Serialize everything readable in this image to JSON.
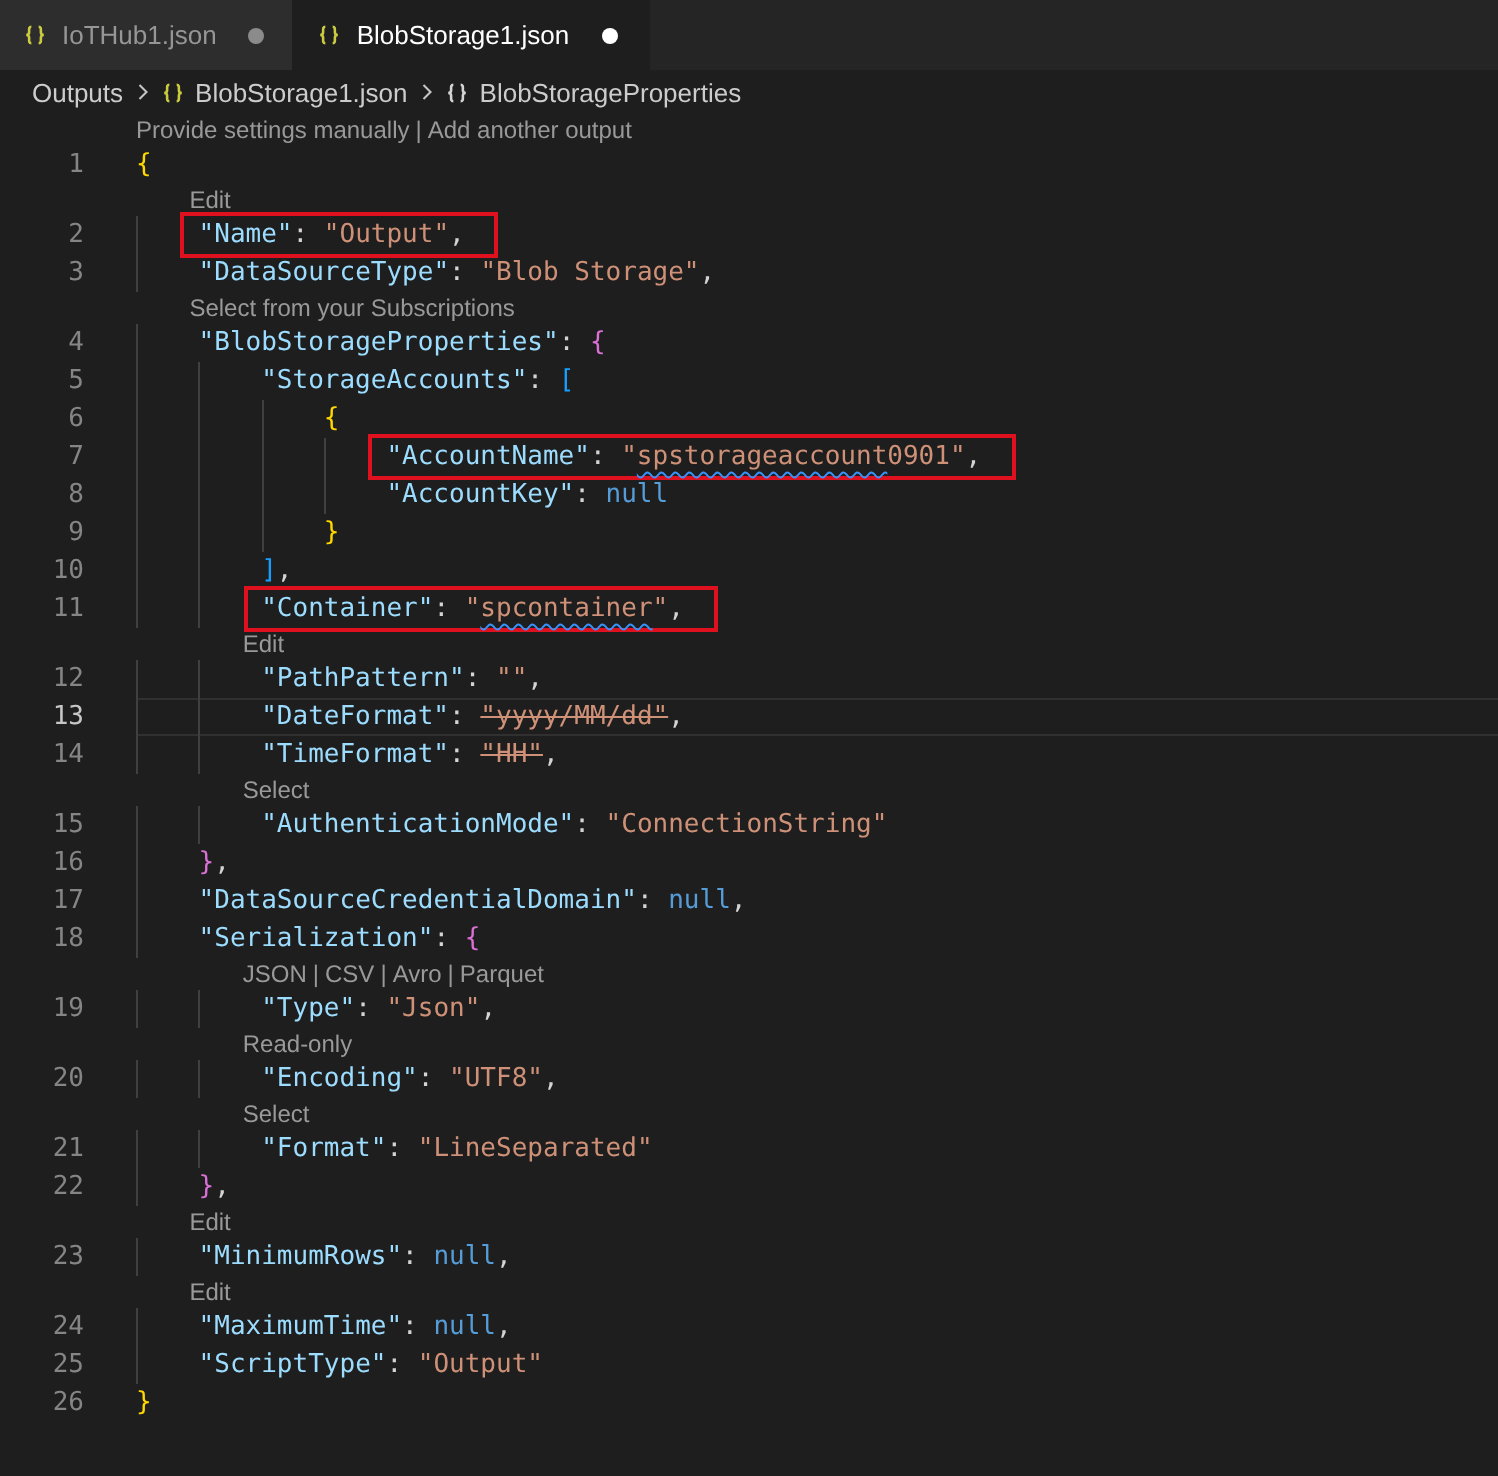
{
  "tabs": [
    {
      "label": "IoTHub1.json",
      "selected": false,
      "modified": true
    },
    {
      "label": "BlobStorage1.json",
      "selected": true,
      "modified": true
    }
  ],
  "breadcrumb": [
    {
      "text": "Outputs",
      "kind": "folder"
    },
    {
      "text": "BlobStorage1.json",
      "kind": "file"
    },
    {
      "text": "BlobStorageProperties",
      "kind": "symbol"
    }
  ],
  "lines": [
    {
      "number": "1",
      "current": false,
      "boxed": false,
      "lens": [
        {
          "text": "Provide settings manually",
          "kind": "link"
        },
        {
          "text": "|",
          "kind": "sep"
        },
        {
          "text": "Add another output",
          "kind": "link"
        }
      ],
      "tokens": [
        {
          "text": "{",
          "kind": "brace1"
        }
      ],
      "children": [
        {
          "number": "2",
          "current": false,
          "boxed": true,
          "lens": [
            {
              "text": "Edit",
              "kind": "link"
            }
          ],
          "tokens": [
            {
              "text": "\"Name\"",
              "kind": "key"
            },
            {
              "text": ": ",
              "kind": "punct"
            },
            {
              "text": "\"Output\"",
              "kind": "string"
            },
            {
              "text": ",",
              "kind": "punct"
            }
          ]
        },
        {
          "number": "3",
          "current": false,
          "boxed": false,
          "tokens": [
            {
              "text": "\"DataSourceType\"",
              "kind": "key"
            },
            {
              "text": ": ",
              "kind": "punct"
            },
            {
              "text": "\"Blob Storage\"",
              "kind": "string"
            },
            {
              "text": ",",
              "kind": "punct"
            }
          ]
        },
        {
          "number": "4",
          "current": false,
          "boxed": false,
          "lens": [
            {
              "text": "Select from your Subscriptions",
              "kind": "link"
            }
          ],
          "tokens": [
            {
              "text": "\"BlobStorageProperties\"",
              "kind": "key"
            },
            {
              "text": ": ",
              "kind": "punct"
            },
            {
              "text": "{",
              "kind": "brace2"
            }
          ],
          "children": [
            {
              "number": "5",
              "current": false,
              "boxed": false,
              "tokens": [
                {
                  "text": "\"StorageAccounts\"",
                  "kind": "key"
                },
                {
                  "text": ": ",
                  "kind": "punct"
                },
                {
                  "text": "[",
                  "kind": "brace3"
                }
              ],
              "children": [
                {
                  "number": "6",
                  "current": false,
                  "boxed": false,
                  "tokens": [
                    {
                      "text": "{",
                      "kind": "brace1"
                    }
                  ],
                  "children": [
                    {
                      "number": "7",
                      "current": false,
                      "boxed": true,
                      "tokens": [
                        {
                          "text": "\"AccountName\"",
                          "kind": "key"
                        },
                        {
                          "text": ": ",
                          "kind": "punct"
                        },
                        {
                          "text": "\"",
                          "kind": "string"
                        },
                        {
                          "text": "spstorageaccount",
                          "kind": "string",
                          "squiggle": true
                        },
                        {
                          "text": "0901\"",
                          "kind": "string"
                        },
                        {
                          "text": ",",
                          "kind": "punct"
                        }
                      ]
                    },
                    {
                      "number": "8",
                      "current": false,
                      "boxed": false,
                      "tokens": [
                        {
                          "text": "\"AccountKey\"",
                          "kind": "key"
                        },
                        {
                          "text": ": ",
                          "kind": "punct"
                        },
                        {
                          "text": "null",
                          "kind": "null"
                        }
                      ]
                    }
                  ]
                },
                {
                  "number": "9",
                  "current": false,
                  "boxed": false,
                  "tokens": [
                    {
                      "text": "}",
                      "kind": "brace1"
                    }
                  ]
                }
              ]
            },
            {
              "number": "10",
              "current": false,
              "boxed": false,
              "tokens": [
                {
                  "text": "]",
                  "kind": "brace3"
                },
                {
                  "text": ",",
                  "kind": "punct"
                }
              ]
            },
            {
              "number": "11",
              "current": false,
              "boxed": true,
              "tokens": [
                {
                  "text": "\"Container\"",
                  "kind": "key"
                },
                {
                  "text": ": ",
                  "kind": "punct"
                },
                {
                  "text": "\"",
                  "kind": "string"
                },
                {
                  "text": "spcontainer",
                  "kind": "string",
                  "squiggle": true
                },
                {
                  "text": "\"",
                  "kind": "string"
                },
                {
                  "text": ",",
                  "kind": "punct"
                }
              ]
            },
            {
              "number": "12",
              "current": false,
              "boxed": false,
              "lens": [
                {
                  "text": "Edit",
                  "kind": "link"
                }
              ],
              "tokens": [
                {
                  "text": "\"PathPattern\"",
                  "kind": "key"
                },
                {
                  "text": ": ",
                  "kind": "punct"
                },
                {
                  "text": "\"\"",
                  "kind": "string"
                },
                {
                  "text": ",",
                  "kind": "punct"
                }
              ]
            },
            {
              "number": "13",
              "current": true,
              "boxed": false,
              "tokens": [
                {
                  "text": "\"DateFormat\"",
                  "kind": "key"
                },
                {
                  "text": ": ",
                  "kind": "punct"
                },
                {
                  "text": "\"yyyy/MM/dd\"",
                  "kind": "string",
                  "deprecated": true
                },
                {
                  "text": ",",
                  "kind": "punct"
                }
              ]
            },
            {
              "number": "14",
              "current": false,
              "boxed": false,
              "tokens": [
                {
                  "text": "\"TimeFormat\"",
                  "kind": "key"
                },
                {
                  "text": ": ",
                  "kind": "punct"
                },
                {
                  "text": "\"HH\"",
                  "kind": "string",
                  "deprecated": true
                },
                {
                  "text": ",",
                  "kind": "punct"
                }
              ]
            },
            {
              "number": "15",
              "current": false,
              "boxed": false,
              "lens": [
                {
                  "text": "Select",
                  "kind": "link"
                }
              ],
              "tokens": [
                {
                  "text": "\"AuthenticationMode\"",
                  "kind": "key"
                },
                {
                  "text": ": ",
                  "kind": "punct"
                },
                {
                  "text": "\"ConnectionString\"",
                  "kind": "string"
                }
              ]
            }
          ]
        },
        {
          "number": "16",
          "current": false,
          "boxed": false,
          "tokens": [
            {
              "text": "}",
              "kind": "brace2"
            },
            {
              "text": ",",
              "kind": "punct"
            }
          ]
        },
        {
          "number": "17",
          "current": false,
          "boxed": false,
          "tokens": [
            {
              "text": "\"DataSourceCredentialDomain\"",
              "kind": "key"
            },
            {
              "text": ": ",
              "kind": "punct"
            },
            {
              "text": "null",
              "kind": "null"
            },
            {
              "text": ",",
              "kind": "punct"
            }
          ]
        },
        {
          "number": "18",
          "current": false,
          "boxed": false,
          "tokens": [
            {
              "text": "\"Serialization\"",
              "kind": "key"
            },
            {
              "text": ": ",
              "kind": "punct"
            },
            {
              "text": "{",
              "kind": "brace2"
            }
          ],
          "children": [
            {
              "number": "19",
              "current": false,
              "boxed": false,
              "lens": [
                {
                  "text": "JSON",
                  "kind": "link"
                },
                {
                  "text": "|",
                  "kind": "sep"
                },
                {
                  "text": "CSV",
                  "kind": "link"
                },
                {
                  "text": "|",
                  "kind": "sep"
                },
                {
                  "text": "Avro",
                  "kind": "link"
                },
                {
                  "text": "|",
                  "kind": "sep"
                },
                {
                  "text": "Parquet",
                  "kind": "link"
                }
              ],
              "tokens": [
                {
                  "text": "\"Type\"",
                  "kind": "key"
                },
                {
                  "text": ": ",
                  "kind": "punct"
                },
                {
                  "text": "\"Json\"",
                  "kind": "string"
                },
                {
                  "text": ",",
                  "kind": "punct"
                }
              ]
            },
            {
              "number": "20",
              "current": false,
              "boxed": false,
              "lens": [
                {
                  "text": "Read-only",
                  "kind": "link"
                }
              ],
              "tokens": [
                {
                  "text": "\"Encoding\"",
                  "kind": "key"
                },
                {
                  "text": ": ",
                  "kind": "punct"
                },
                {
                  "text": "\"UTF8\"",
                  "kind": "string"
                },
                {
                  "text": ",",
                  "kind": "punct"
                }
              ]
            },
            {
              "number": "21",
              "current": false,
              "boxed": false,
              "lens": [
                {
                  "text": "Select",
                  "kind": "link"
                }
              ],
              "tokens": [
                {
                  "text": "\"Format\"",
                  "kind": "key"
                },
                {
                  "text": ": ",
                  "kind": "punct"
                },
                {
                  "text": "\"LineSeparated\"",
                  "kind": "string"
                }
              ]
            }
          ]
        },
        {
          "number": "22",
          "current": false,
          "boxed": false,
          "tokens": [
            {
              "text": "}",
              "kind": "brace2"
            },
            {
              "text": ",",
              "kind": "punct"
            }
          ]
        },
        {
          "number": "23",
          "current": false,
          "boxed": false,
          "lens": [
            {
              "text": "Edit",
              "kind": "link"
            }
          ],
          "tokens": [
            {
              "text": "\"MinimumRows\"",
              "kind": "key"
            },
            {
              "text": ": ",
              "kind": "punct"
            },
            {
              "text": "null",
              "kind": "null"
            },
            {
              "text": ",",
              "kind": "punct"
            }
          ]
        },
        {
          "number": "24",
          "current": false,
          "boxed": false,
          "lens": [
            {
              "text": "Edit",
              "kind": "link"
            }
          ],
          "tokens": [
            {
              "text": "\"MaximumTime\"",
              "kind": "key"
            },
            {
              "text": ": ",
              "kind": "punct"
            },
            {
              "text": "null",
              "kind": "null"
            },
            {
              "text": ",",
              "kind": "punct"
            }
          ]
        },
        {
          "number": "25",
          "current": false,
          "boxed": false,
          "tokens": [
            {
              "text": "\"ScriptType\"",
              "kind": "key"
            },
            {
              "text": ": ",
              "kind": "punct"
            },
            {
              "text": "\"Output\"",
              "kind": "string"
            }
          ]
        }
      ]
    },
    {
      "number": "26",
      "current": false,
      "boxed": false,
      "tokens": [
        {
          "text": "}",
          "kind": "brace1"
        }
      ]
    }
  ]
}
